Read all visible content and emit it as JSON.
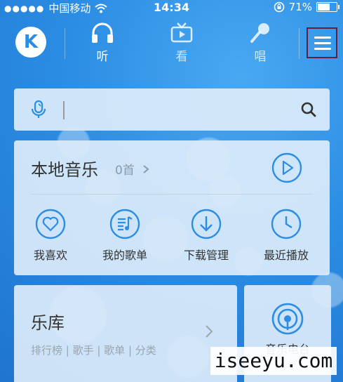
{
  "status_bar": {
    "signal": "●●●●●",
    "carrier": "中国移动",
    "time": "14:34",
    "battery": "71%",
    "battery_level": 0.71
  },
  "nav": {
    "logo": "K",
    "tabs": [
      {
        "label": "听",
        "icon": "headphones-icon",
        "active": true
      },
      {
        "label": "看",
        "icon": "tv-icon",
        "active": false
      },
      {
        "label": "唱",
        "icon": "microphone-icon",
        "active": false
      }
    ],
    "menu_icon": "menu-icon"
  },
  "search": {
    "placeholder": "",
    "value": ""
  },
  "local_music": {
    "title": "本地音乐",
    "count": "0首",
    "shortcuts": [
      {
        "label": "我喜欢",
        "icon": "heart-icon"
      },
      {
        "label": "我的歌单",
        "icon": "playlist-icon"
      },
      {
        "label": "下载管理",
        "icon": "download-icon"
      },
      {
        "label": "最近播放",
        "icon": "clock-icon"
      }
    ]
  },
  "library": {
    "title": "乐库",
    "subtitle": "排行榜 | 歌手 | 歌单 | 分类"
  },
  "radio": {
    "label": "音乐电台"
  },
  "watermark": "iseeyu.com",
  "colors": {
    "accent": "#2b8de3",
    "background": "#2a86dc",
    "card": "#dcebf9",
    "menu_highlight": "#6a1d3a"
  }
}
